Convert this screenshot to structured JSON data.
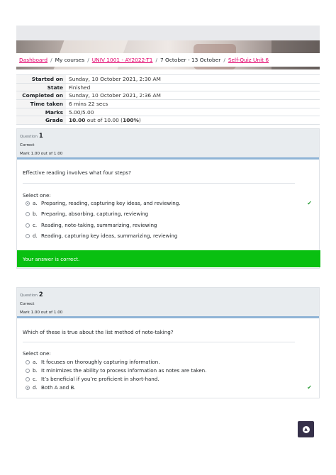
{
  "breadcrumb": {
    "items": [
      "Dashboard",
      "My courses",
      "UNIV 1001 - AY2022-T1",
      "7 October - 13 October",
      "Self-Quiz Unit 6"
    ],
    "separator": "/"
  },
  "summary": [
    {
      "key": "Started on",
      "value": "Sunday, 10 October 2021, 2:30 AM"
    },
    {
      "key": "State",
      "value": "Finished"
    },
    {
      "key": "Completed on",
      "value": "Sunday, 10 October 2021, 2:36 AM"
    },
    {
      "key": "Time taken",
      "value": "6 mins 22 secs"
    },
    {
      "key": "Marks",
      "value": "5.00/5.00"
    },
    {
      "key": "Grade",
      "value_bold": "10.00",
      "value_mid": " out of 10.00 (",
      "value_pct": "100%",
      "value_end": ")"
    }
  ],
  "questions": [
    {
      "label": "Question",
      "number": "1",
      "state": "Correct",
      "mark": "Mark 1.00 out of 1.00",
      "text": "Effective reading involves what four steps?",
      "select_label": "Select one:",
      "options": [
        {
          "letter": "a.",
          "text": "Preparing, reading, capturing key ideas, and reviewing."
        },
        {
          "letter": "b.",
          "text": "Preparing, absorbing, capturing, reviewing"
        },
        {
          "letter": "c.",
          "text": "Reading, note-taking, summarizing, reviewing"
        },
        {
          "letter": "d.",
          "text": "Reading, capturing key ideas, summarizing, reviewing"
        }
      ],
      "selected_option": "a.",
      "feedback": "Your answer is correct."
    },
    {
      "label": "Question",
      "number": "2",
      "state": "Correct",
      "mark": "Mark 1.00 out of 1.00",
      "text": "Which of these is true about the list method of note-taking?",
      "select_label": "Select one:",
      "options": [
        {
          "letter": "a.",
          "text": "It focuses on thoroughly capturing information."
        },
        {
          "letter": "b.",
          "text": "It minimizes the ability to process information as notes are taken."
        },
        {
          "letter": "c.",
          "text": "It’s beneficial if you’re proficient in short-hand."
        },
        {
          "letter": "d.",
          "text": "Both A and B."
        }
      ],
      "selected_option": "d."
    }
  ],
  "icons": {
    "correct": "check-icon",
    "back_to_top": "arrow-up-icon"
  },
  "colors": {
    "link": "#e1006a",
    "correct_feedback": "#09c011",
    "check": "#2e9e3a",
    "back_to_top": "#36304a"
  }
}
